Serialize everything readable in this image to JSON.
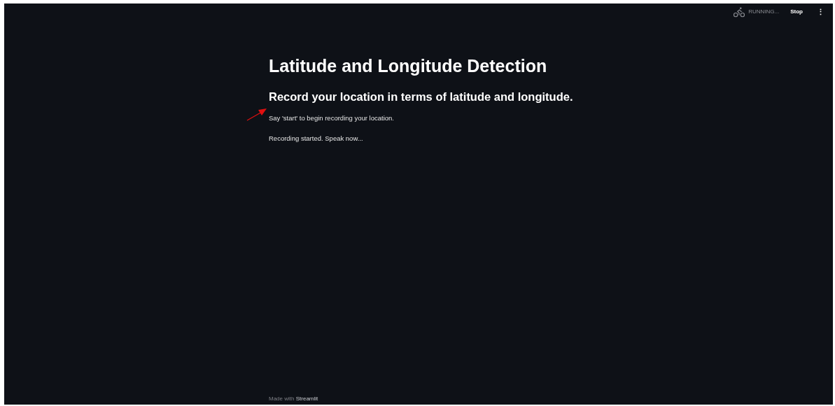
{
  "toolbar": {
    "status": "RUNNING...",
    "stop_label": "Stop",
    "menu_icon": "⋮"
  },
  "title": "Latitude and Longitude Detection",
  "subheading": "Record your location in terms of latitude and longitude.",
  "messages": [
    "Say 'start' to begin recording your location.",
    "Recording started. Speak now..."
  ],
  "footer": {
    "prefix": "Made with",
    "brand": "Streamlit"
  }
}
